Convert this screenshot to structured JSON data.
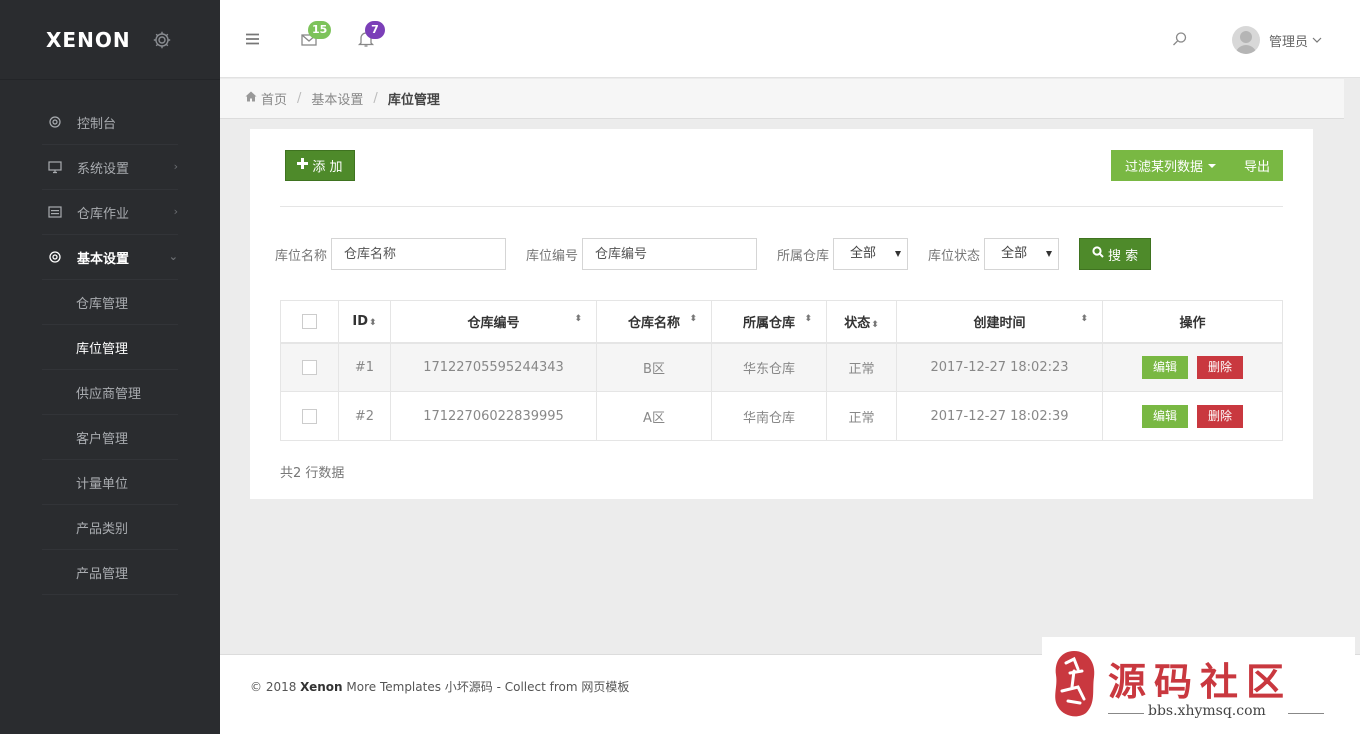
{
  "brand": {
    "logo": "XENON",
    "settings_icon": "gear-icon"
  },
  "sidebar": {
    "items": [
      {
        "label": "控制台",
        "icon": "gear-icon",
        "has_children": false
      },
      {
        "label": "系统设置",
        "icon": "monitor-icon",
        "has_children": true
      },
      {
        "label": "仓库作业",
        "icon": "warehouse-icon",
        "has_children": true
      },
      {
        "label": "基本设置",
        "icon": "gear-icon",
        "has_children": true,
        "expanded": true
      }
    ],
    "sub_items": [
      {
        "label": "仓库管理"
      },
      {
        "label": "库位管理",
        "active": true
      },
      {
        "label": "供应商管理"
      },
      {
        "label": "客户管理"
      },
      {
        "label": "计量单位"
      },
      {
        "label": "产品类别"
      },
      {
        "label": "产品管理"
      }
    ]
  },
  "topbar": {
    "mail_count": "15",
    "notification_count": "7",
    "user_name": "管理员",
    "colors": {
      "mail_badge": "#7dc35b",
      "notification_badge": "#7b3fb8"
    }
  },
  "breadcrumb": {
    "home": "首页",
    "parent": "基本设置",
    "current": "库位管理"
  },
  "toolbar": {
    "add_label": "添 加",
    "filter_label": "过滤某列数据",
    "export_label": "导出"
  },
  "search": {
    "location_name_label": "库位名称",
    "location_name_placeholder": "仓库名称",
    "location_code_label": "库位编号",
    "location_code_placeholder": "仓库编号",
    "warehouse_label": "所属仓库",
    "warehouse_value": "全部",
    "status_label": "库位状态",
    "status_value": "全部",
    "search_label": "搜 索"
  },
  "table": {
    "headers": [
      "ID",
      "仓库编号",
      "仓库名称",
      "所属仓库",
      "状态",
      "创建时间",
      "操作"
    ],
    "rows": [
      {
        "id": "#1",
        "code": "17122705595244343",
        "name": "B区",
        "warehouse": "华东仓库",
        "status": "正常",
        "created": "2017-12-27 18:02:23"
      },
      {
        "id": "#2",
        "code": "17122706022839995",
        "name": "A区",
        "warehouse": "华南仓库",
        "status": "正常",
        "created": "2017-12-27 18:02:39"
      }
    ],
    "edit_label": "编辑",
    "delete_label": "删除",
    "summary": "共2 行数据"
  },
  "footer": {
    "prefix": "© 2018 ",
    "brand": "Xenon",
    "suffix": " More Templates 小坏源码 - Collect from 网页模板"
  },
  "watermark": {
    "title": "源码社区",
    "url": "bbs.xhymsq.com",
    "seal_text": "小坏"
  },
  "colors": {
    "accent_green": "#79b843",
    "dark_green": "#4e8a2a",
    "danger": "#c9383f",
    "sidebar_bg": "#2a2c2f"
  }
}
